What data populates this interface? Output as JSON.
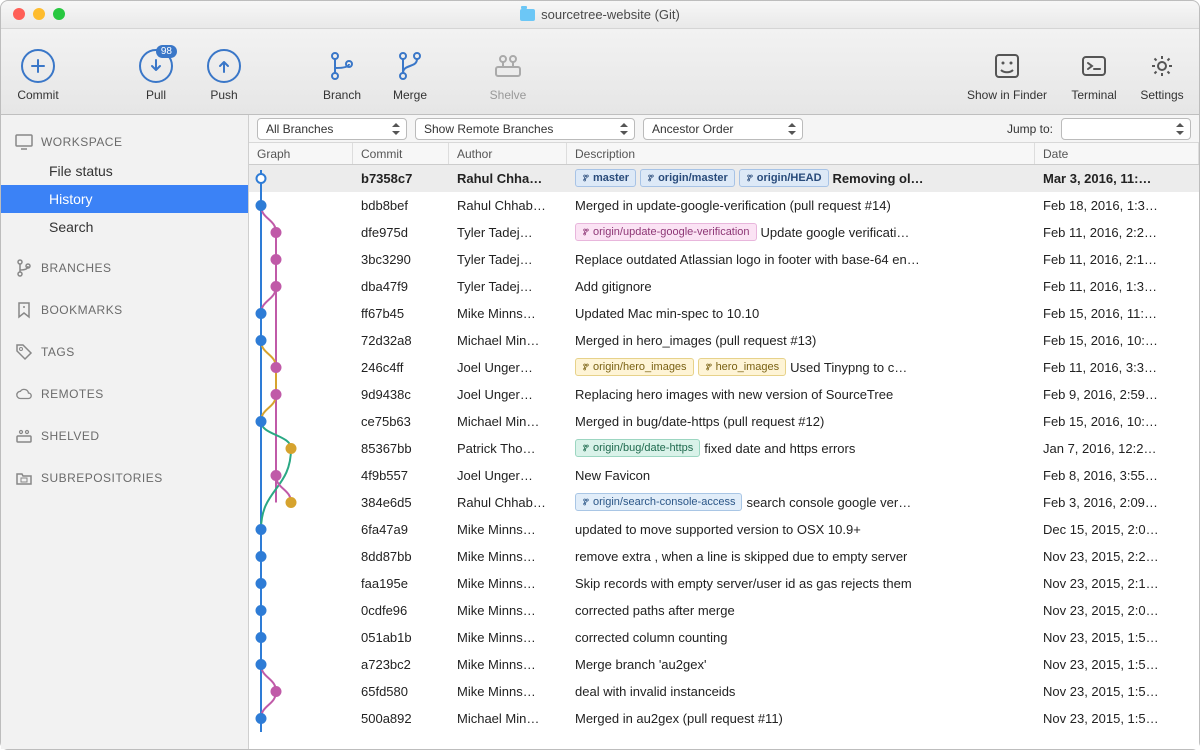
{
  "window": {
    "title": "sourcetree-website (Git)"
  },
  "toolbar": {
    "commit": "Commit",
    "pull": "Pull",
    "pull_badge": "98",
    "push": "Push",
    "branch": "Branch",
    "merge": "Merge",
    "shelve": "Shelve",
    "show_in_finder": "Show in Finder",
    "terminal": "Terminal",
    "settings": "Settings"
  },
  "sidebar": {
    "sections": [
      {
        "title": "WORKSPACE",
        "icon": "monitor",
        "items": [
          "File status",
          "History",
          "Search"
        ],
        "selected": 1
      },
      {
        "title": "BRANCHES",
        "icon": "branch"
      },
      {
        "title": "BOOKMARKS",
        "icon": "bookmark"
      },
      {
        "title": "TAGS",
        "icon": "tag"
      },
      {
        "title": "REMOTES",
        "icon": "cloud"
      },
      {
        "title": "SHELVED",
        "icon": "shelf"
      },
      {
        "title": "SUBREPOSITORIES",
        "icon": "subrepo"
      }
    ]
  },
  "filters": {
    "branches": "All Branches",
    "remote": "Show Remote Branches",
    "order": "Ancestor Order",
    "jump_to_label": "Jump to:",
    "jump_to": ""
  },
  "columns": {
    "graph": "Graph",
    "commit": "Commit",
    "author": "Author",
    "desc": "Description",
    "date": "Date"
  },
  "commits": [
    {
      "hash": "b7358c7",
      "author": "Rahul Chha…",
      "tags": [
        {
          "t": "master",
          "c": "master"
        },
        {
          "t": "origin/master",
          "c": "master"
        },
        {
          "t": "origin/HEAD",
          "c": "master"
        }
      ],
      "desc": "Removing ol…",
      "date": "Mar 3, 2016, 11:…",
      "sel": true
    },
    {
      "hash": "bdb8bef",
      "author": "Rahul Chhab…",
      "tags": [],
      "desc": "Merged in update-google-verification (pull request #14)",
      "date": "Feb 18, 2016, 1:3…"
    },
    {
      "hash": "dfe975d",
      "author": "Tyler Tadej…",
      "tags": [
        {
          "t": "origin/update-google-verification",
          "c": "pink"
        }
      ],
      "desc": "Update google verificati…",
      "date": "Feb 11, 2016, 2:2…"
    },
    {
      "hash": "3bc3290",
      "author": "Tyler Tadej…",
      "tags": [],
      "desc": "Replace outdated Atlassian logo in footer with base-64 en…",
      "date": "Feb 11, 2016, 2:1…"
    },
    {
      "hash": "dba47f9",
      "author": "Tyler Tadej…",
      "tags": [],
      "desc": "Add gitignore",
      "date": "Feb 11, 2016, 1:3…"
    },
    {
      "hash": "ff67b45",
      "author": "Mike Minns…",
      "tags": [],
      "desc": "Updated Mac min-spec to 10.10",
      "date": "Feb 15, 2016, 11:…"
    },
    {
      "hash": "72d32a8",
      "author": "Michael Min…",
      "tags": [],
      "desc": "Merged in hero_images (pull request #13)",
      "date": "Feb 15, 2016, 10:…"
    },
    {
      "hash": "246c4ff",
      "author": "Joel Unger…",
      "tags": [
        {
          "t": "origin/hero_images",
          "c": "yellow"
        },
        {
          "t": "hero_images",
          "c": "yellow"
        }
      ],
      "desc": "Used Tinypng to c…",
      "date": "Feb 11, 2016, 3:3…"
    },
    {
      "hash": "9d9438c",
      "author": "Joel Unger…",
      "tags": [],
      "desc": "Replacing hero images with new version of SourceTree",
      "date": "Feb 9, 2016, 2:59…"
    },
    {
      "hash": "ce75b63",
      "author": "Michael Min…",
      "tags": [],
      "desc": "Merged in bug/date-https (pull request #12)",
      "date": "Feb 15, 2016, 10:…"
    },
    {
      "hash": "85367bb",
      "author": "Patrick Tho…",
      "tags": [
        {
          "t": "origin/bug/date-https",
          "c": "teal"
        }
      ],
      "desc": "fixed date and https errors",
      "date": "Jan 7, 2016, 12:2…"
    },
    {
      "hash": "4f9b557",
      "author": "Joel Unger…",
      "tags": [],
      "desc": "New Favicon",
      "date": "Feb 8, 2016, 3:55…"
    },
    {
      "hash": "384e6d5",
      "author": "Rahul Chhab…",
      "tags": [
        {
          "t": "origin/search-console-access",
          "c": "blue"
        }
      ],
      "desc": "search console google ver…",
      "date": "Feb 3, 2016, 2:09…"
    },
    {
      "hash": "6fa47a9",
      "author": "Mike Minns…",
      "tags": [],
      "desc": "updated to move supported version to OSX 10.9+",
      "date": "Dec 15, 2015, 2:0…"
    },
    {
      "hash": "8dd87bb",
      "author": "Mike Minns…",
      "tags": [],
      "desc": "remove extra , when a line is skipped due to empty server",
      "date": "Nov 23, 2015, 2:2…"
    },
    {
      "hash": "faa195e",
      "author": "Mike Minns…",
      "tags": [],
      "desc": "Skip records with empty server/user id as gas rejects them",
      "date": "Nov 23, 2015, 2:1…"
    },
    {
      "hash": "0cdfe96",
      "author": "Mike Minns…",
      "tags": [],
      "desc": "corrected paths after merge",
      "date": "Nov 23, 2015, 2:0…"
    },
    {
      "hash": "051ab1b",
      "author": "Mike Minns…",
      "tags": [],
      "desc": " corrected column counting",
      "date": "Nov 23, 2015, 1:5…"
    },
    {
      "hash": "a723bc2",
      "author": "Mike Minns…",
      "tags": [],
      "desc": "Merge branch 'au2gex'",
      "date": "Nov 23, 2015, 1:5…"
    },
    {
      "hash": "65fd580",
      "author": "Mike Minns…",
      "tags": [],
      "desc": "deal with invalid instanceids",
      "date": "Nov 23, 2015, 1:5…"
    },
    {
      "hash": "500a892",
      "author": "Michael Min…",
      "tags": [],
      "desc": "Merged in au2gex (pull request #11)",
      "date": "Nov 23, 2015, 1:5…"
    }
  ]
}
